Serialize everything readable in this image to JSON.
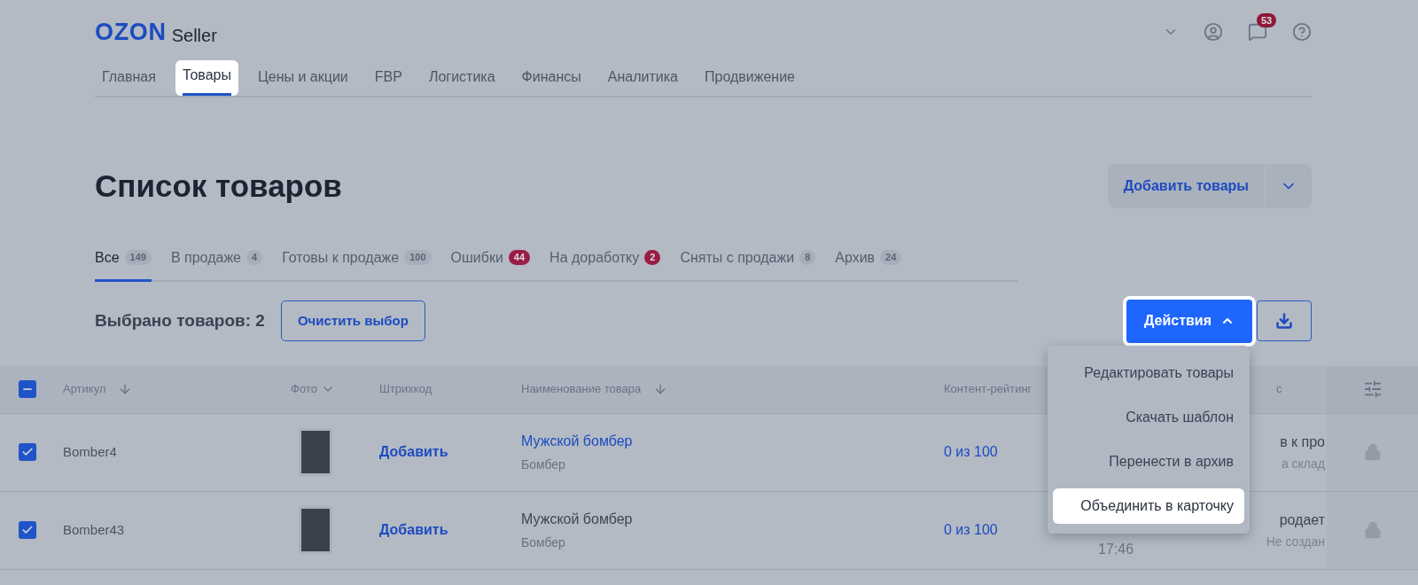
{
  "header": {
    "logo": {
      "brand": "OZON",
      "product": "Seller"
    },
    "messages_badge": "53"
  },
  "nav": [
    {
      "label": "Главная",
      "selected": false
    },
    {
      "label": "Товары",
      "selected": true
    },
    {
      "label": "Цены и акции",
      "selected": false
    },
    {
      "label": "FBP",
      "selected": false
    },
    {
      "label": "Логистика",
      "selected": false
    },
    {
      "label": "Финансы",
      "selected": false
    },
    {
      "label": "Аналитика",
      "selected": false
    },
    {
      "label": "Продвижение",
      "selected": false
    }
  ],
  "page": {
    "title": "Список товаров",
    "add_button": "Добавить товары"
  },
  "tabs": [
    {
      "label": "Все",
      "count": "149",
      "alert": false,
      "selected": true
    },
    {
      "label": "В продаже",
      "count": "4",
      "alert": false,
      "selected": false
    },
    {
      "label": "Готовы к продаже",
      "count": "100",
      "alert": false,
      "selected": false
    },
    {
      "label": "Ошибки",
      "count": "44",
      "alert": true,
      "selected": false
    },
    {
      "label": "На доработку",
      "count": "2",
      "alert": true,
      "selected": false
    },
    {
      "label": "Сняты с продажи",
      "count": "8",
      "alert": false,
      "selected": false
    },
    {
      "label": "Архив",
      "count": "24",
      "alert": false,
      "selected": false
    }
  ],
  "selection": {
    "text": "Выбрано товаров: 2",
    "clear_button": "Очистить выбор"
  },
  "actions": {
    "label": "Действия",
    "expanded": true,
    "menu": [
      {
        "label": "Редактировать товары",
        "selected": false
      },
      {
        "label": "Скачать шаблон",
        "selected": false
      },
      {
        "label": "Перенести в архив",
        "selected": false
      },
      {
        "label": "Объединить в карточку",
        "selected": true
      }
    ]
  },
  "table": {
    "header_checkbox": {
      "indeterminate": true
    },
    "columns": [
      "Артикул",
      "Фото",
      "Штрихкод",
      "Наименование товара",
      "Контент-рейтинг",
      "с"
    ],
    "rows": [
      {
        "checked": true,
        "article": "Bomber4",
        "barcode": "Добавить",
        "name": "Мужской бомбер",
        "name_link": true,
        "category": "Бомбер",
        "rating": "0 из 100",
        "status": "в к про",
        "status_note": "а склад",
        "locked": true
      },
      {
        "checked": true,
        "article": "Bomber43",
        "barcode": "Добавить",
        "name": "Мужской бомбер",
        "name_link": false,
        "category": "Бомбер",
        "rating": "0 из 100",
        "date": "17:46",
        "status": "родает",
        "status_note": "Не создан",
        "locked": true
      }
    ]
  }
}
